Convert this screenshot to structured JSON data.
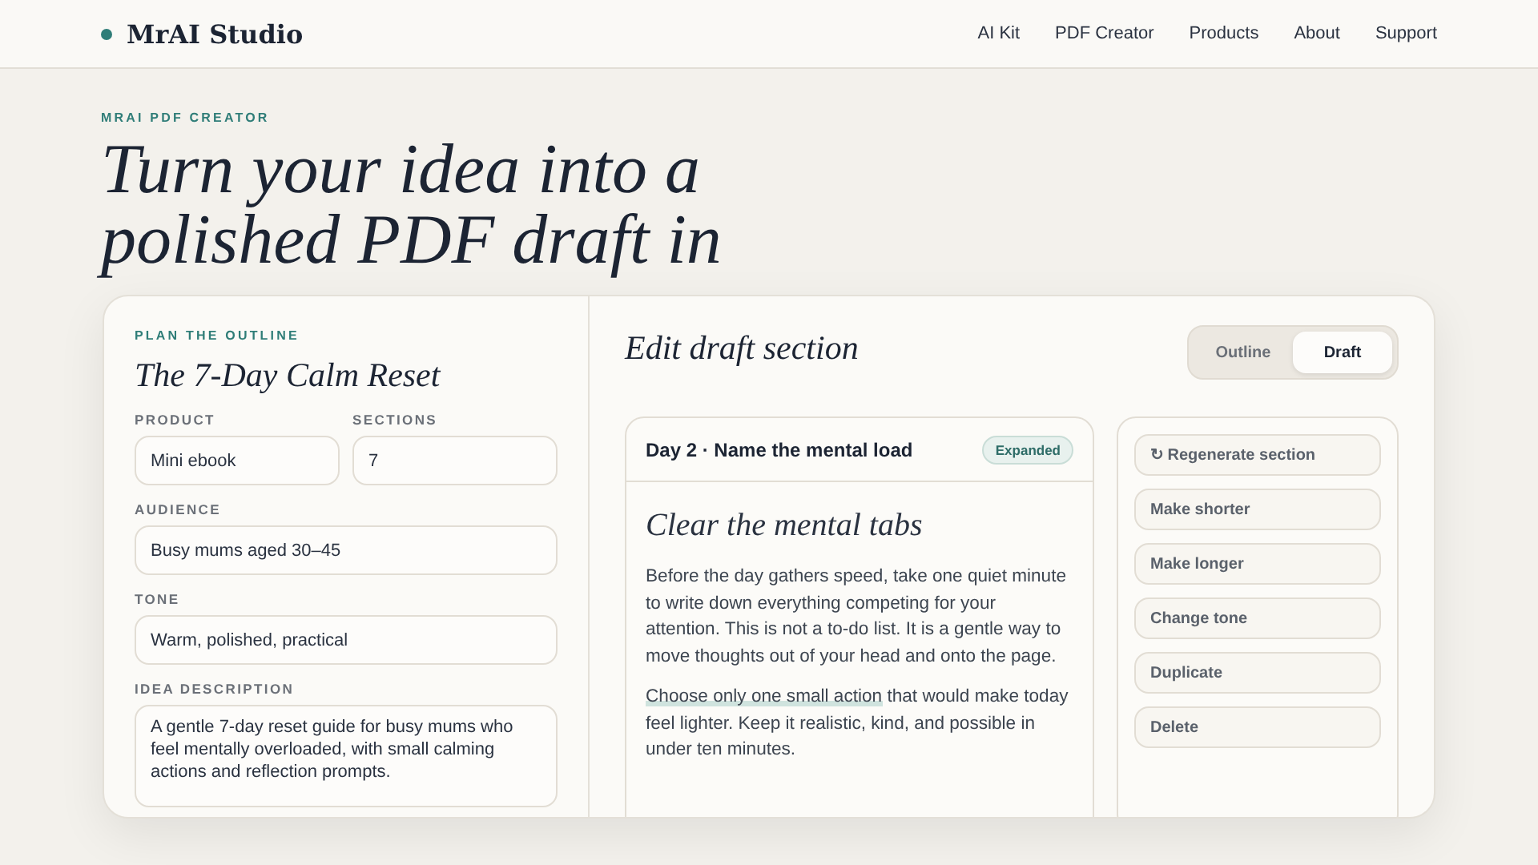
{
  "brand": {
    "name": "MrAI Studio"
  },
  "nav": [
    {
      "label": "AI Kit"
    },
    {
      "label": "PDF Creator"
    },
    {
      "label": "Products"
    },
    {
      "label": "About"
    },
    {
      "label": "Support"
    }
  ],
  "hero": {
    "eyebrow": "MRAI PDF CREATOR",
    "title_lines": [
      "Turn your idea into a",
      "polished PDF draft in"
    ]
  },
  "outline": {
    "eyebrow": "PLAN THE OUTLINE",
    "title": "The 7-Day Calm Reset",
    "fields": [
      {
        "label": "PRODUCT",
        "value": "Mini ebook",
        "kind": "half"
      },
      {
        "label": "SECTIONS",
        "value": "7",
        "kind": "half"
      },
      {
        "label": "AUDIENCE",
        "value": "Busy mums aged 30–45",
        "kind": "full"
      },
      {
        "label": "TONE",
        "value": "Warm, polished, practical",
        "kind": "full"
      },
      {
        "label": "IDEA DESCRIPTION",
        "value": "A gentle 7-day reset guide for busy mums who feel mentally overloaded, with small calming actions and reflection prompts.",
        "kind": "area"
      }
    ]
  },
  "editor": {
    "title": "Edit draft section",
    "tabs": [
      {
        "label": "Outline",
        "selected": false
      },
      {
        "label": "Draft",
        "selected": true
      }
    ],
    "section": {
      "title": "Day 2 · Name the mental load",
      "badge": "Expanded",
      "heading": "Clear the mental tabs",
      "paragraphs": [
        {
          "text": "Before the day gathers speed, take one quiet minute to write down everything competing for your attention. This is not a to-do list. It is a gentle way to move thoughts out of your head and onto the page."
        },
        {
          "highlight": "Choose only one small action",
          "text": " that would make today feel lighter. Keep it realistic, kind, and possible in under ten minutes."
        }
      ]
    },
    "actions": [
      "↻ Regenerate section",
      "Make shorter",
      "Make longer",
      "Change tone",
      "Duplicate",
      "Delete"
    ]
  }
}
